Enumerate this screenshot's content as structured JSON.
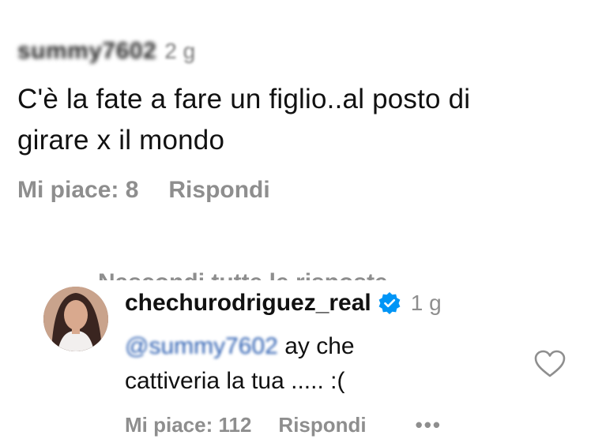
{
  "top_comment": {
    "username": "summy7602",
    "time": "2 g",
    "text_line1": "C'è la fate a fare un figlio..al posto di",
    "text_line2": "girare x il mondo",
    "likes_label": "Mi piace: 8",
    "reply_label": "Rispondi"
  },
  "hide_replies_label": "Nascondi tutte le risposte",
  "reply": {
    "username": "chechurodriguez_real",
    "time": "1 g",
    "mention": "@summy7602",
    "text_part1": " ay che",
    "text_line2": "cattiveria la tua ..... :(",
    "likes_label": "Mi piace: 112",
    "reply_label": "Rispondi",
    "more_label": "•••"
  },
  "colors": {
    "muted": "#8e8e8e",
    "verified": "#0095f6",
    "mention": "#2a5db0"
  },
  "icons": [
    "verified-badge-icon",
    "heart-icon",
    "more-options-icon",
    "avatar"
  ]
}
